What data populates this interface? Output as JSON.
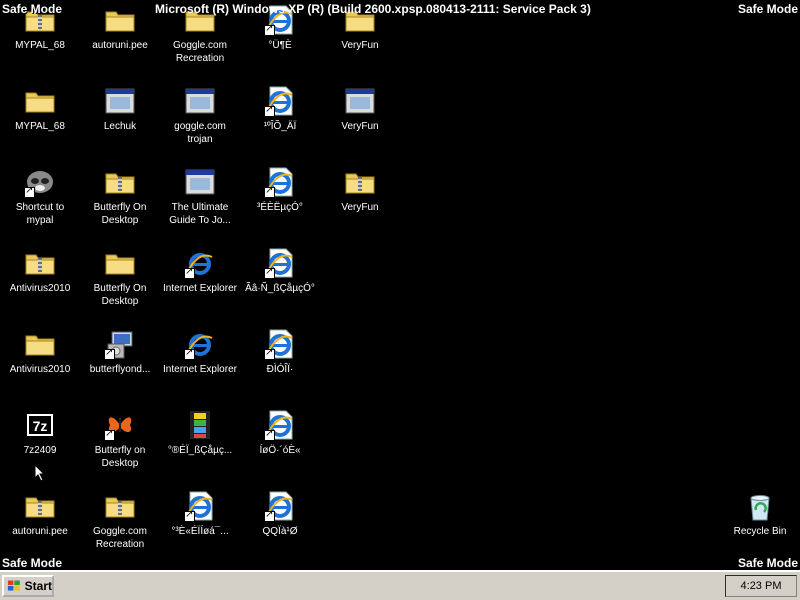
{
  "safe_mode": "Safe Mode",
  "title_banner": "Microsoft (R) Windows XP (R) (Build 2600.xpsp.080413-2111: Service Pack 3)",
  "desktop_icons": [
    {
      "label": "MYPAL_68",
      "icon": "zip-folder-icon"
    },
    {
      "label": "autoruni.pee",
      "icon": "folder-icon"
    },
    {
      "label": "Goggle.com Recreation",
      "icon": "folder-icon"
    },
    {
      "label": "°Ü¶È",
      "icon": "ie-document-shortcut-icon"
    },
    {
      "label": "VeryFun",
      "icon": "folder-icon"
    },
    {
      "label": "MYPAL_68",
      "icon": "folder-icon"
    },
    {
      "label": "Lechuk",
      "icon": "application-window-icon"
    },
    {
      "label": "goggle.com trojan",
      "icon": "application-window-icon"
    },
    {
      "label": "¹ºÎÕ_ÄÏ",
      "icon": "ie-document-shortcut-icon"
    },
    {
      "label": "VeryFun",
      "icon": "application-window-icon"
    },
    {
      "label": "Shortcut to mypal",
      "icon": "raccoon-shortcut-icon"
    },
    {
      "label": "Butterfly On Desktop",
      "icon": "zip-folder-icon"
    },
    {
      "label": "The Ultimate Guide To Jo...",
      "icon": "application-window-icon"
    },
    {
      "label": "³ÉÈËµçÓ°",
      "icon": "ie-document-shortcut-icon"
    },
    {
      "label": "VeryFun",
      "icon": "zip-folder-icon"
    },
    {
      "label": "Antivirus2010",
      "icon": "zip-folder-icon"
    },
    {
      "label": "Butterfly On Desktop",
      "icon": "folder-icon"
    },
    {
      "label": "Internet Explorer",
      "icon": "internet-explorer-icon"
    },
    {
      "label": "Ãâ·Ñ_ßÇåµçÓ°",
      "icon": "ie-document-shortcut-icon"
    },
    {
      "label": "Antivirus2010",
      "icon": "folder-icon"
    },
    {
      "label": "butterflyond...",
      "icon": "installer-icon"
    },
    {
      "label": "Internet Explorer",
      "icon": "internet-explorer-icon"
    },
    {
      "label": "ÐÌÓÎÏ·",
      "icon": "ie-document-shortcut-icon"
    },
    {
      "label": "7z2409",
      "icon": "7zip-icon"
    },
    {
      "label": "Butterfly on Desktop",
      "icon": "butterfly-icon"
    },
    {
      "label": "°®ÉÏ_ßÇåµç...",
      "icon": "film-icon"
    },
    {
      "label": "ÍøÖ·´óÈ«",
      "icon": "ie-document-shortcut-icon"
    },
    {
      "label": "autoruni.pee",
      "icon": "zip-folder-icon"
    },
    {
      "label": "Goggle.com Recreation",
      "icon": "zip-folder-icon"
    },
    {
      "label": "°³È«ÉÏÍøá¯...",
      "icon": "ie-document-shortcut-icon"
    },
    {
      "label": "QQÏà¹Ø",
      "icon": "ie-document-shortcut-icon"
    },
    {
      "label": "Recycle Bin",
      "icon": "recycle-bin-icon"
    }
  ],
  "taskbar": {
    "start_label": "Start",
    "clock": "4:23 PM"
  }
}
